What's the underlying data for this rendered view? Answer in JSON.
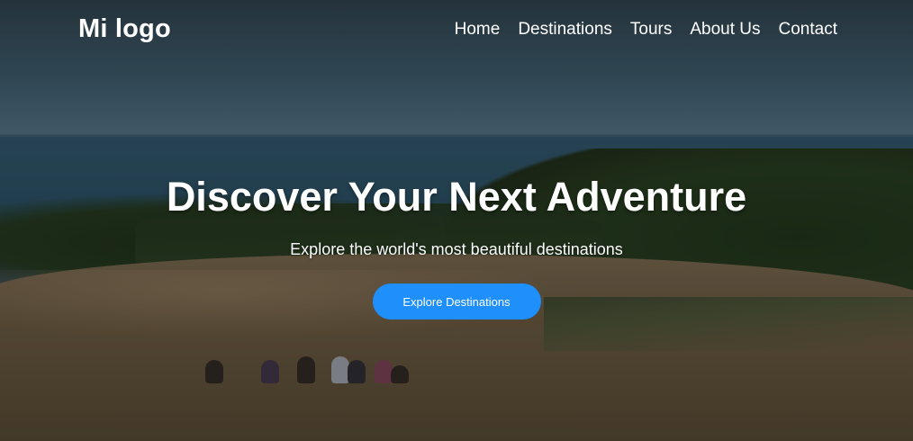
{
  "brand": {
    "logo_text": "Mi logo"
  },
  "nav": {
    "items": [
      {
        "label": "Home"
      },
      {
        "label": "Destinations"
      },
      {
        "label": "Tours"
      },
      {
        "label": "About Us"
      },
      {
        "label": "Contact"
      }
    ]
  },
  "hero": {
    "title": "Discover Your Next Adventure",
    "subtitle": "Explore the world's most beautiful destinations",
    "cta_label": "Explore Destinations",
    "background_image": "coastal-sand-dune-with-people",
    "accent_color": "#1e8ffb"
  }
}
